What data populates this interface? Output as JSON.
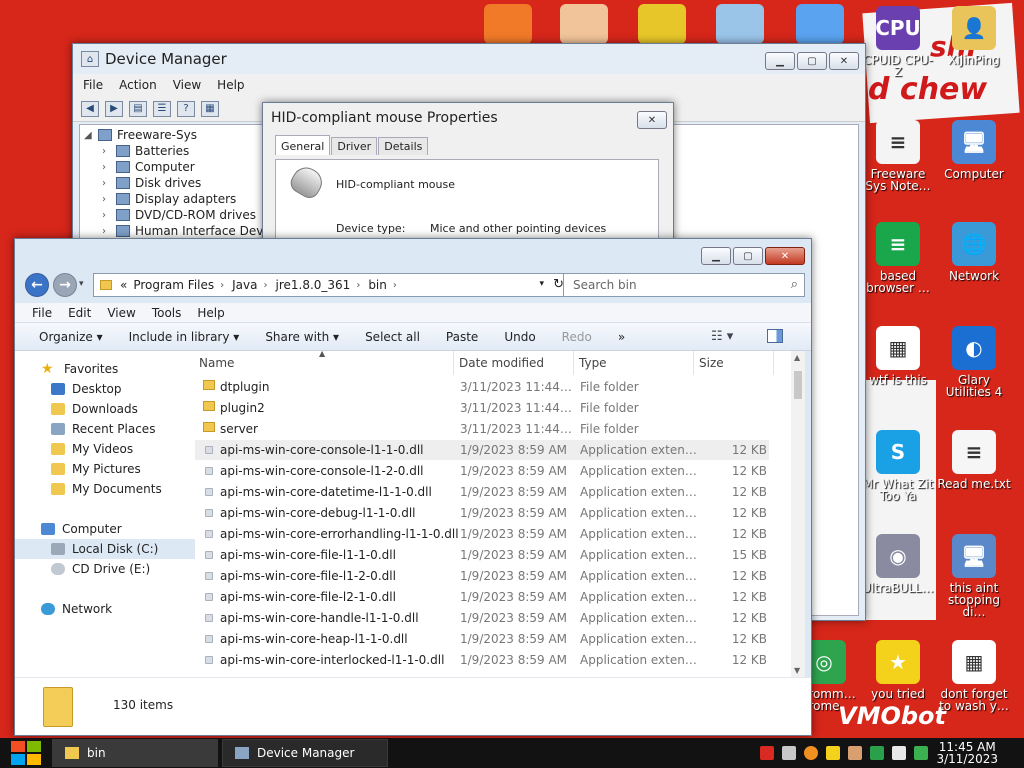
{
  "desktop": {
    "wallpaper_text": [
      "shi",
      "d chew",
      "VMObot"
    ],
    "top_icons": [
      {
        "name": "orange-app-icon",
        "color": "#f07a28"
      },
      {
        "name": "user-figure-icon",
        "color": "#f2c49a"
      },
      {
        "name": "de-app-icon",
        "color": "#e7c629"
      },
      {
        "name": "hxd-app-icon",
        "color": "#9ac4e8"
      },
      {
        "name": "colorful-ball-icon",
        "color": "#5aa3f0"
      }
    ],
    "icons": [
      {
        "label": "CPUID CPU-Z",
        "name": "cpuz-icon",
        "color": "#6a40b0",
        "glyph": "CPU"
      },
      {
        "label": "XiJinPing",
        "name": "folder-person-icon",
        "color": "#e8c45a",
        "glyph": "👤"
      },
      {
        "label": "Freeware Sys Note…",
        "name": "notepad-doc-icon",
        "color": "#f4f4f4",
        "glyph": "≡"
      },
      {
        "label": "Computer",
        "name": "computer-icon",
        "color": "#4c88d4",
        "glyph": "🖥"
      },
      {
        "label": "based browser …",
        "name": "green-browser-icon",
        "color": "#1aa64a",
        "glyph": "≡"
      },
      {
        "label": "Network",
        "name": "network-globe-icon",
        "color": "#3a9ad8",
        "glyph": "🌐"
      },
      {
        "label": "wtf is this",
        "name": "calendar-doc-icon",
        "color": "#ffffff",
        "glyph": "▦"
      },
      {
        "label": "Glary Utilities 4",
        "name": "glary-icon",
        "color": "#1c6fd2",
        "glyph": "◐"
      },
      {
        "label": "Mr What Zit Too Ya",
        "name": "skype-icon",
        "color": "#1aa0e4",
        "glyph": "S"
      },
      {
        "label": "Read me.txt",
        "name": "text-file-icon",
        "color": "#f6f6f6",
        "glyph": "≡"
      },
      {
        "label": "UltraBULL…",
        "name": "disc-icon",
        "color": "#8a8aa0",
        "glyph": "◉"
      },
      {
        "label": "this aint stopping di…",
        "name": "computer-tools-icon",
        "color": "#5a88c8",
        "glyph": "🖥"
      },
      {
        "label": "Chromm… rome",
        "name": "chrome-icon",
        "color": "#2ea44f",
        "glyph": "◎"
      },
      {
        "label": "you tried",
        "name": "star-icon",
        "color": "#f4d21c",
        "glyph": "★"
      },
      {
        "label": "dont forget to wash y…",
        "name": "calendar-doc-icon-2",
        "color": "#ffffff",
        "glyph": "▦"
      }
    ]
  },
  "device_manager": {
    "title": "Device Manager",
    "menu": [
      "File",
      "Action",
      "View",
      "Help"
    ],
    "tree_root": "Freeware-Sys",
    "tree_items": [
      "Batteries",
      "Computer",
      "Disk drives",
      "Display adapters",
      "DVD/CD-ROM drives",
      "Human Interface Devi"
    ]
  },
  "properties": {
    "title": "HID-compliant mouse Properties",
    "tabs": [
      "General",
      "Driver",
      "Details"
    ],
    "device_name": "HID-compliant mouse",
    "device_type_label": "Device type:",
    "device_type_value": "Mice and other pointing devices"
  },
  "explorer": {
    "breadcrumb_prefix": "«",
    "breadcrumb": [
      "Program Files",
      "Java",
      "jre1.8.0_361",
      "bin"
    ],
    "search_placeholder": "Search bin",
    "menu": [
      "File",
      "Edit",
      "View",
      "Tools",
      "Help"
    ],
    "commands": {
      "organize": "Organize ▾",
      "include": "Include in library ▾",
      "share": "Share with ▾",
      "select_all": "Select all",
      "paste": "Paste",
      "undo": "Undo",
      "redo": "Redo",
      "more": "»"
    },
    "nav": {
      "favorites": "Favorites",
      "desktop": "Desktop",
      "downloads": "Downloads",
      "recent": "Recent Places",
      "videos": "My Videos",
      "pictures": "My Pictures",
      "documents": "My Documents",
      "computer": "Computer",
      "local_disk": "Local Disk (C:)",
      "cd_drive": "CD Drive (E:)",
      "network": "Network"
    },
    "columns": {
      "name": "Name",
      "date": "Date modified",
      "type": "Type",
      "size": "Size"
    },
    "files": [
      {
        "name": "dtplugin",
        "date": "3/11/2023 11:44…",
        "type": "File folder",
        "size": "",
        "kind": "folder"
      },
      {
        "name": "plugin2",
        "date": "3/11/2023 11:44…",
        "type": "File folder",
        "size": "",
        "kind": "folder"
      },
      {
        "name": "server",
        "date": "3/11/2023 11:44…",
        "type": "File folder",
        "size": "",
        "kind": "folder"
      },
      {
        "name": "api-ms-win-core-console-l1-1-0.dll",
        "date": "1/9/2023 8:59 AM",
        "type": "Application exten…",
        "size": "12 KB",
        "kind": "dll"
      },
      {
        "name": "api-ms-win-core-console-l1-2-0.dll",
        "date": "1/9/2023 8:59 AM",
        "type": "Application exten…",
        "size": "12 KB",
        "kind": "dll"
      },
      {
        "name": "api-ms-win-core-datetime-l1-1-0.dll",
        "date": "1/9/2023 8:59 AM",
        "type": "Application exten…",
        "size": "12 KB",
        "kind": "dll"
      },
      {
        "name": "api-ms-win-core-debug-l1-1-0.dll",
        "date": "1/9/2023 8:59 AM",
        "type": "Application exten…",
        "size": "12 KB",
        "kind": "dll"
      },
      {
        "name": "api-ms-win-core-errorhandling-l1-1-0.dll",
        "date": "1/9/2023 8:59 AM",
        "type": "Application exten…",
        "size": "12 KB",
        "kind": "dll"
      },
      {
        "name": "api-ms-win-core-file-l1-1-0.dll",
        "date": "1/9/2023 8:59 AM",
        "type": "Application exten…",
        "size": "15 KB",
        "kind": "dll"
      },
      {
        "name": "api-ms-win-core-file-l1-2-0.dll",
        "date": "1/9/2023 8:59 AM",
        "type": "Application exten…",
        "size": "12 KB",
        "kind": "dll"
      },
      {
        "name": "api-ms-win-core-file-l2-1-0.dll",
        "date": "1/9/2023 8:59 AM",
        "type": "Application exten…",
        "size": "12 KB",
        "kind": "dll"
      },
      {
        "name": "api-ms-win-core-handle-l1-1-0.dll",
        "date": "1/9/2023 8:59 AM",
        "type": "Application exten…",
        "size": "12 KB",
        "kind": "dll"
      },
      {
        "name": "api-ms-win-core-heap-l1-1-0.dll",
        "date": "1/9/2023 8:59 AM",
        "type": "Application exten…",
        "size": "12 KB",
        "kind": "dll"
      },
      {
        "name": "api-ms-win-core-interlocked-l1-1-0.dll",
        "date": "1/9/2023 8:59 AM",
        "type": "Application exten…",
        "size": "12 KB",
        "kind": "dll"
      }
    ],
    "item_count": "130 items"
  },
  "taskbar": {
    "tasks": [
      {
        "label": "bin",
        "name": "task-explorer-bin"
      },
      {
        "label": "Device Manager",
        "name": "task-device-manager"
      }
    ],
    "time": "11:45 AM",
    "date": "3/11/2023"
  },
  "colors": {
    "desktop_red": "#d7261a",
    "explorer_accent": "#4a7fc8",
    "folder_yellow": "#f0c850",
    "taskbar": "#121212"
  }
}
